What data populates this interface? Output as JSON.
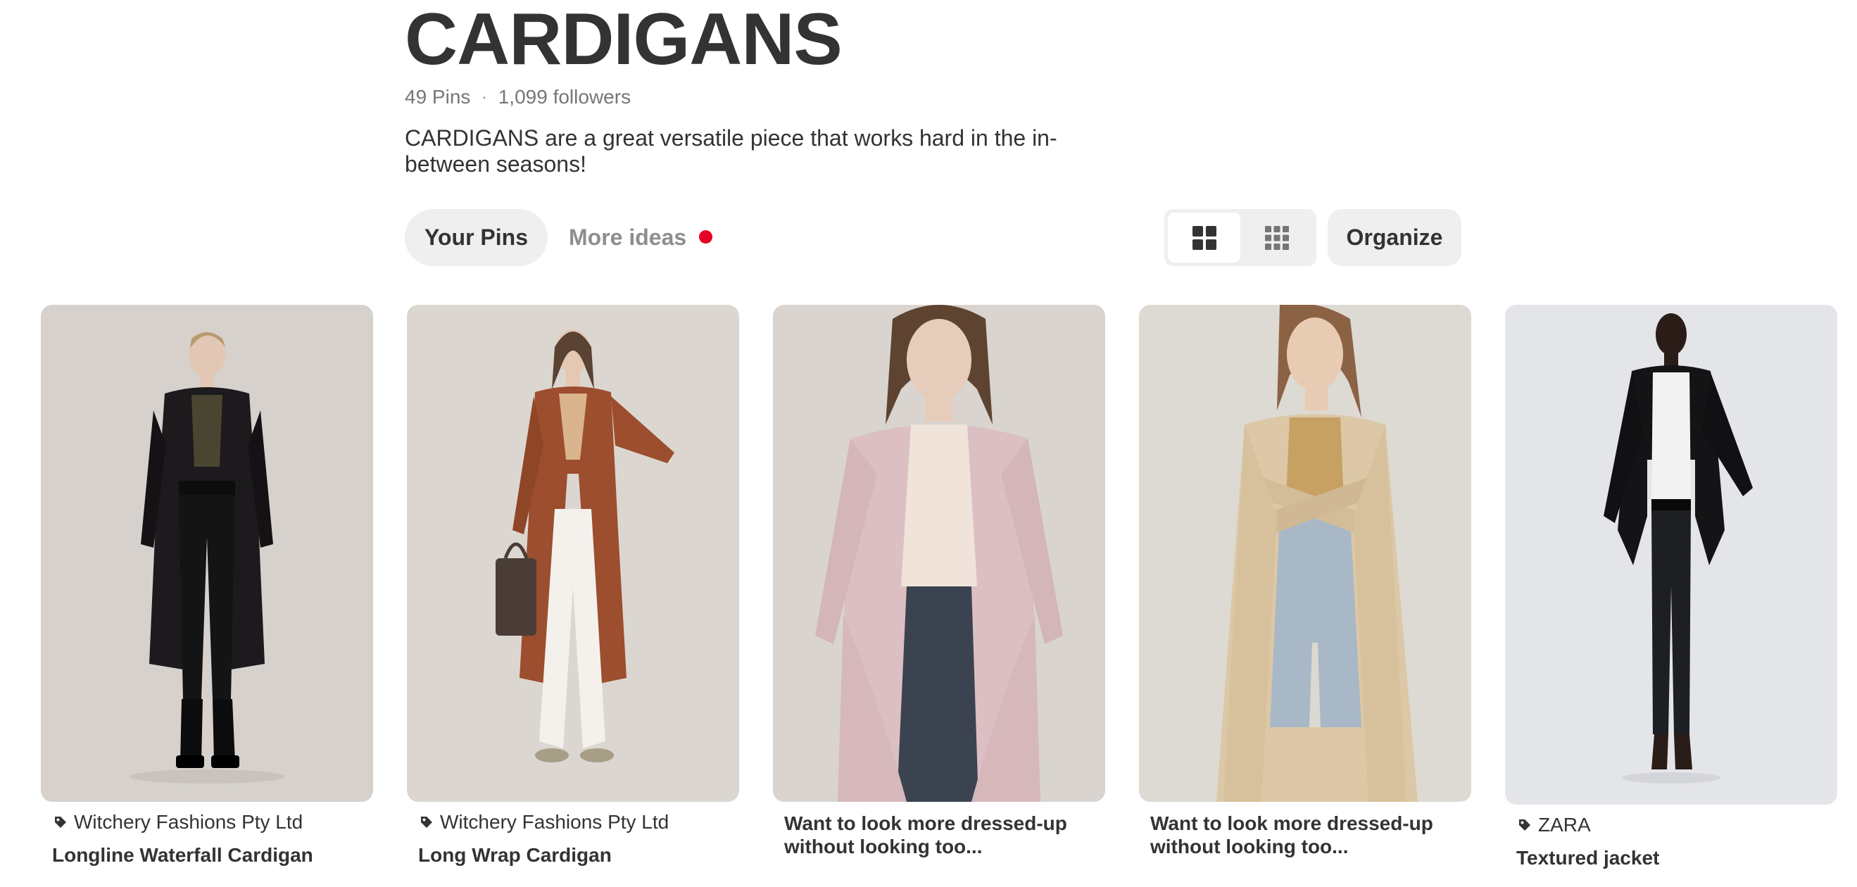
{
  "board": {
    "title": "CARDIGANS",
    "pin_count": "49 Pins",
    "separator": "·",
    "followers": "1,099 followers",
    "description": "CARDIGANS are a great versatile piece that works hard in the in-between seasons!"
  },
  "tabs": {
    "your_pins": "Your Pins",
    "more_ideas": "More ideas"
  },
  "view_options": {
    "default_icon": "grid-default-icon",
    "compact_icon": "grid-compact-icon",
    "selected": "default"
  },
  "organize": {
    "label": "Organize"
  },
  "pins": [
    {
      "source": "Witchery Fashions Pty Ltd",
      "title": "Longline Waterfall Cardigan",
      "image": "photo-black-longline-cardigan",
      "source_icon": "tag-icon"
    },
    {
      "source": "Witchery Fashions Pty Ltd",
      "title": "Long Wrap Cardigan",
      "image": "photo-rust-wrap-cardigan",
      "source_icon": "tag-icon"
    },
    {
      "source": "",
      "title": "Want to look more dressed-up without looking too...",
      "image": "photo-pink-waterfall-cardigan"
    },
    {
      "source": "",
      "title": "Want to look more dressed-up without looking too...",
      "image": "photo-beige-long-cardigan"
    },
    {
      "source": "ZARA",
      "title": "Textured jacket",
      "image": "photo-black-textured-jacket",
      "source_icon": "tag-icon"
    }
  ],
  "colors": {
    "text": "#333333",
    "muted": "#767676",
    "pill_bg": "#efefef",
    "notify": "#e60023"
  }
}
